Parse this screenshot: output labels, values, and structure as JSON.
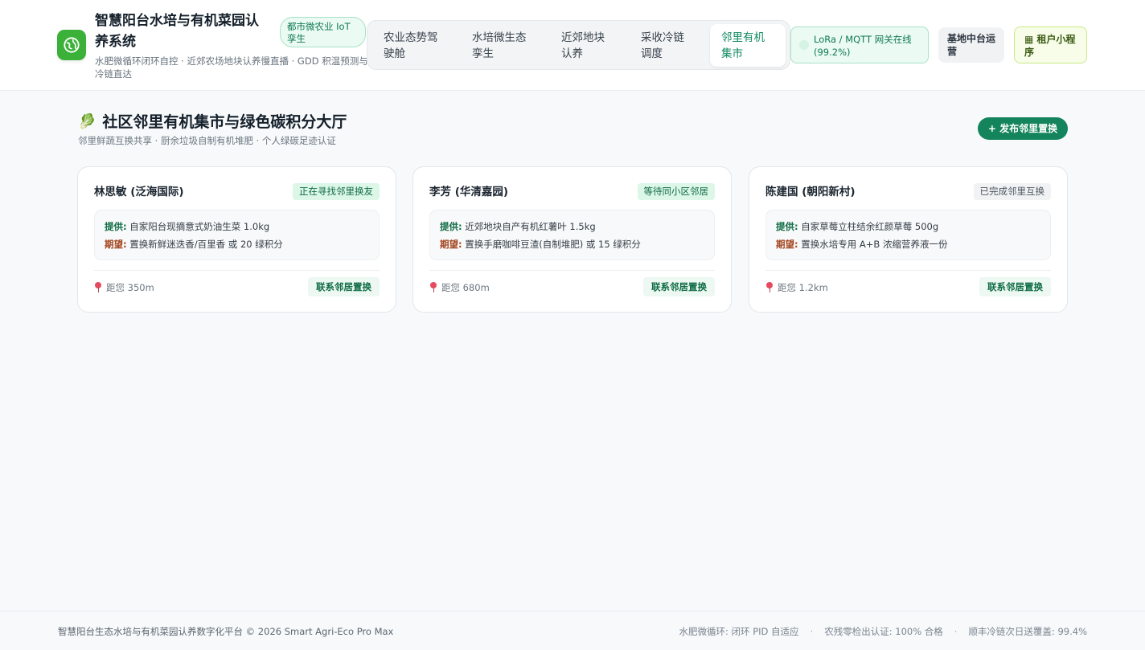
{
  "header": {
    "title": "智慧阳台水培与有机菜园认养系统",
    "subtitle": "水肥微循环闭环自控 · 近郊农场地块认养慢直播 · GDD 积温预测与冷链直达",
    "badge": "都市微农业 IoT 孪生",
    "tabs": [
      {
        "label": "农业态势驾驶舱",
        "active": false
      },
      {
        "label": "水培微生态孪生",
        "active": false
      },
      {
        "label": "近郊地块认养",
        "active": false
      },
      {
        "label": "采收冷链调度",
        "active": false
      },
      {
        "label": "邻里有机集市",
        "active": true
      }
    ],
    "gateway_status": "LoRa / MQTT 网关在线 (99.2%)",
    "ops_button": "基地中台运营",
    "mini_program_button": "▦ 租户小程序"
  },
  "main": {
    "title_icon": "🥬",
    "title": "社区邻里有机集市与绿色碳积分大厅",
    "subtitle": "邻里鲜蔬互换共享 · 厨余垃圾自制有机堆肥 · 个人绿碳足迹认证",
    "publish_button": "+ 发布邻里置换",
    "offer_label": "提供:",
    "want_label": "期望:",
    "contact_label": "联系邻居置换",
    "cards": [
      {
        "name": "林思敏 (泛海国际)",
        "status": "正在寻找邻里换友",
        "status_color": "green",
        "offer": "自家阳台现摘意式奶油生菜 1.0kg",
        "want": "置换新鲜迷迭香/百里香 或 20 绿积分",
        "distance": "距您 350m"
      },
      {
        "name": "李芳 (华清嘉园)",
        "status": "等待同小区邻居",
        "status_color": "green",
        "offer": "近郊地块自产有机红薯叶 1.5kg",
        "want": "置换手磨咖啡豆渣(自制堆肥) 或 15 绿积分",
        "distance": "距您 680m"
      },
      {
        "name": "陈建国 (朝阳新村)",
        "status": "已完成邻里互换",
        "status_color": "gray",
        "offer": "自家草莓立柱结余红颜草莓 500g",
        "want": "置换水培专用 A+B 浓缩营养液一份",
        "distance": "距您 1.2km"
      }
    ]
  },
  "footer": {
    "copyright": "智慧阳台生态水培与有机菜园认养数字化平台 © 2026 Smart Agri-Eco Pro Max",
    "stat_1": "水肥微循环: 闭环 PID 自适应",
    "stat_2": "农残零检出认证: 100% 合格",
    "stat_3": "顺丰冷链次日送覆盖: 99.4%",
    "separator": "·"
  }
}
